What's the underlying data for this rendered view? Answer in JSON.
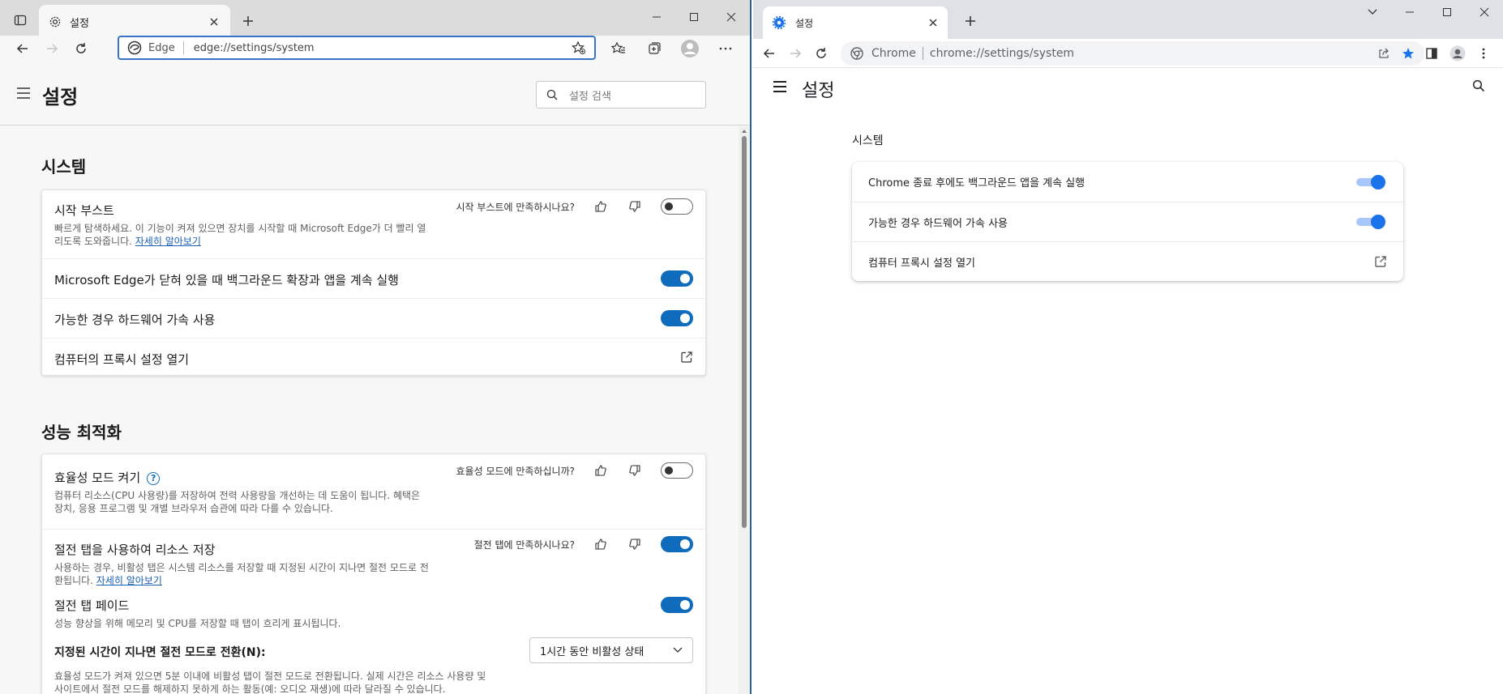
{
  "edge": {
    "tab_title": "설정",
    "address": {
      "brand": "Edge",
      "url": "edge://settings/system"
    },
    "header_title": "설정",
    "search_placeholder": "설정 검색",
    "system": {
      "title": "시스템",
      "startup_boost": {
        "label": "시작 부스트",
        "feedback_q": "시작 부스트에 만족하시나요?",
        "desc": "빠르게 탐색하세요. 이 기능이 켜져 있으면 장치를 시작할 때 Microsoft Edge가 더 빨리 열",
        "desc2": "리도록 도와줍니다. ",
        "link": "자세히 알아보기",
        "enabled": false
      },
      "background": {
        "label": "Microsoft Edge가 닫혀 있을 때 백그라운드 확장과 앱을 계속 실행",
        "enabled": true
      },
      "hardware": {
        "label": "가능한 경우 하드웨어 가속 사용",
        "enabled": true
      },
      "proxy": {
        "label": "컴퓨터의 프록시 설정 열기"
      }
    },
    "performance": {
      "title": "성능 최적화",
      "efficiency": {
        "label": "효율성 모드 켜기",
        "help": "?",
        "feedback_q": "효율성 모드에 만족하십니까?",
        "desc": "컴퓨터 리소스(CPU 사용량)를 저장하여 전력 사용량을 개선하는 데 도움이 됩니다. 혜택은",
        "desc2": "장치, 응용 프로그램 및 개별 브라우저 습관에 따라 다를 수 있습니다.",
        "enabled": false
      },
      "sleeping_tabs": {
        "label": "절전 탭을 사용하여 리소스 저장",
        "feedback_q": "절전 탭에 만족하시나요?",
        "desc": "사용하는 경우, 비활성 탭은 시스템 리소스를 저장할 때 지정된 시간이 지나면 절전 모드로 전",
        "desc2": "환됩니다. ",
        "link": "자세히 알아보기",
        "enabled": true
      },
      "fade": {
        "label": "절전 탭 페이드",
        "desc": "성능 향상을 위해 메모리 및 CPU를 저장할 때 탭이 흐리게 표시됩니다.",
        "enabled": true
      },
      "timeout": {
        "label": "지정된 시간이 지나면 절전 모드로 전환(N):",
        "value": "1시간 동안 비활성 상태",
        "desc": "효율성 모드가 켜져 있으면 5분 이내에 비활성 탭이 절전 모드로 전환됩니다. 실제 시간은 리소스 사용량 및",
        "desc2": "사이트에서 절전 모드를 해제하지 못하게 하는 활동(예: 오디오 재생)에 따라 달라질 수 있습니다."
      }
    }
  },
  "chrome": {
    "tab_title": "설정",
    "address": {
      "brand": "Chrome",
      "url": "chrome://settings/system"
    },
    "header_title": "설정",
    "section_title": "시스템",
    "rows": [
      {
        "label": "Chrome 종료 후에도 백그라운드 앱을 계속 실행",
        "enabled": true
      },
      {
        "label": "가능한 경우 하드웨어 가속 사용",
        "enabled": true
      },
      {
        "label": "컴퓨터 프록시 설정 열기"
      }
    ]
  },
  "colors": {
    "edge_accent": "#0f6cbd",
    "chrome_accent": "#1a73e8",
    "edge_frame": "#2a5f9e"
  },
  "icons": [
    "sidebar-icon",
    "gear-icon",
    "close-icon",
    "plus-icon",
    "minimize-icon",
    "maximize-icon",
    "back-icon",
    "forward-icon",
    "refresh-icon",
    "favorite-add-icon",
    "favorites-icon",
    "collections-icon",
    "profile-icon",
    "more-icon",
    "hamburger-icon",
    "search-icon",
    "thumbs-up-icon",
    "thumbs-down-icon",
    "external-link-icon",
    "chevron-down-icon",
    "share-icon",
    "star-icon",
    "side-panel-icon",
    "chrome-icon"
  ]
}
